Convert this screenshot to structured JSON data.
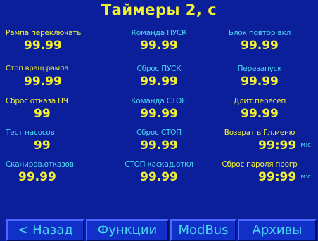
{
  "title": "Таймеры 2,  с",
  "grid": [
    [
      {
        "label": "Рампа переключать",
        "value": "99.99"
      },
      {
        "label": "Команда ПУСК",
        "value": "99.99"
      },
      {
        "label": "Блок повтор вкл",
        "value": "99.99"
      }
    ],
    [
      {
        "label": "Стоп вращ.рампа",
        "value": "99.99"
      },
      {
        "label": "Сброс ПУСК",
        "value": "99.99"
      },
      {
        "label": "Перезапуск",
        "value": "99.99"
      }
    ],
    [
      {
        "label": "Сброс отказа ПЧ",
        "value": "99"
      },
      {
        "label": "Команда СТОП",
        "value": "99.99"
      },
      {
        "label": "Длит.пересеп",
        "value": "99.99"
      }
    ],
    [
      {
        "label": "Тест насосов",
        "value": "99"
      },
      {
        "label": "Сброс СТОП",
        "value": "99.99"
      },
      {
        "label": "Возврат в Гл.меню",
        "value": "99:99",
        "unit": "м:с"
      }
    ],
    [
      {
        "label": "Сканиров.отказов",
        "value": "99.99"
      },
      {
        "label": "СТОП каскад.откл",
        "value": "99.99"
      },
      {
        "label": "Сброс пароля прогр",
        "value": "99:99",
        "unit": "м:с"
      }
    ]
  ],
  "buttons": [
    "< Назад",
    "Функции",
    "ModBus",
    "Архивы"
  ],
  "colors": {
    "background": "#0c1f9a",
    "yellow": "#f4f032",
    "cyan": "#46d8f2",
    "button": "#1130c8"
  }
}
